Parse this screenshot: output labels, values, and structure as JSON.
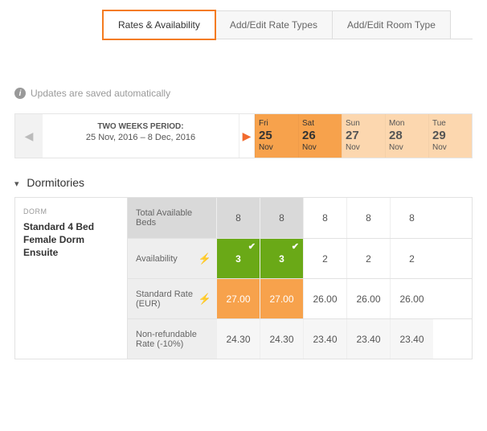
{
  "tabs": {
    "rates": "Rates & Availability",
    "rate_types": "Add/Edit Rate Types",
    "room_types": "Add/Edit Room Type"
  },
  "notice": "Updates are saved automatically",
  "period": {
    "label": "TWO WEEKS PERIOD:",
    "range": "25 Nov, 2016 – 8 Dec, 2016"
  },
  "days": [
    {
      "dow": "Fri",
      "num": "25",
      "mon": "Nov",
      "tone": "hot"
    },
    {
      "dow": "Sat",
      "num": "26",
      "mon": "Nov",
      "tone": "hot"
    },
    {
      "dow": "Sun",
      "num": "27",
      "mon": "Nov",
      "tone": "warm"
    },
    {
      "dow": "Mon",
      "num": "28",
      "mon": "Nov",
      "tone": "warm"
    },
    {
      "dow": "Tue",
      "num": "29",
      "mon": "Nov",
      "tone": "warm"
    }
  ],
  "section": "Dormitories",
  "dorm": {
    "tag": "DORM",
    "name": "Standard 4 Bed Female Dorm Ensuite"
  },
  "rows": {
    "total": {
      "label": "Total Available Beds",
      "values": [
        "8",
        "8",
        "8",
        "8",
        "8"
      ]
    },
    "avail": {
      "label": "Availability",
      "values": [
        "3",
        "3",
        "2",
        "2",
        "2"
      ]
    },
    "std": {
      "label": "Standard Rate (EUR)",
      "values": [
        "27.00",
        "27.00",
        "26.00",
        "26.00",
        "26.00"
      ]
    },
    "nonref": {
      "label": "Non-refundable Rate (-10%)",
      "values": [
        "24.30",
        "24.30",
        "23.40",
        "23.40",
        "23.40"
      ]
    }
  }
}
